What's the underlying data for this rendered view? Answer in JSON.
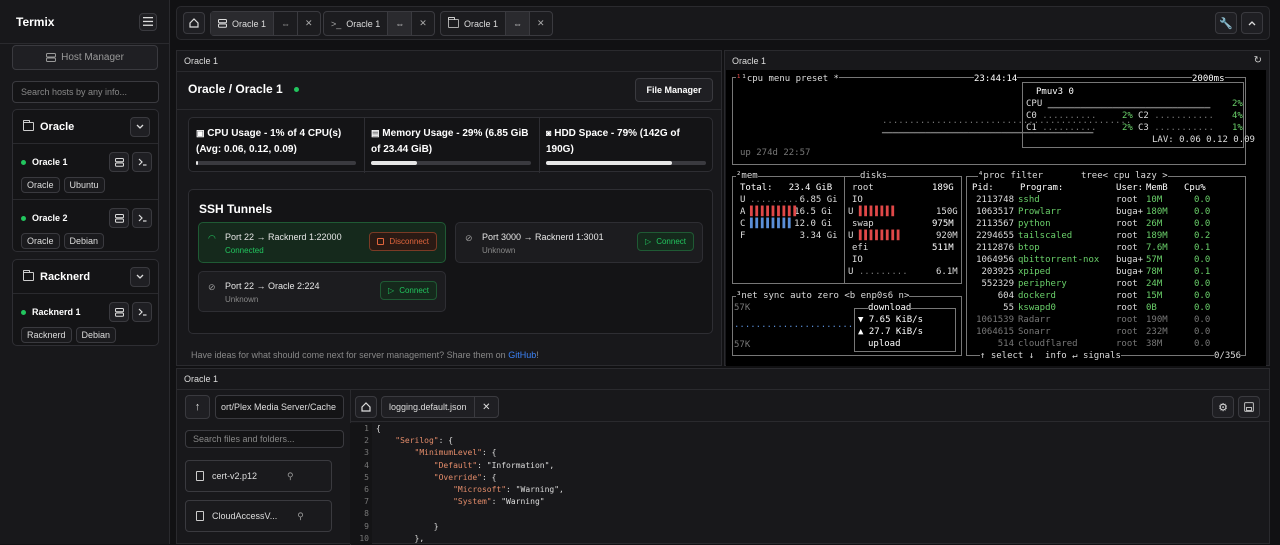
{
  "sidebar": {
    "app_title": "Termix",
    "host_manager": "Host Manager",
    "search_placeholder": "Search hosts by any info...",
    "groups": [
      {
        "name": "Oracle",
        "hosts": [
          {
            "name": "Oracle 1",
            "tags": [
              "Oracle",
              "Ubuntu"
            ]
          },
          {
            "name": "Oracle 2",
            "tags": [
              "Oracle",
              "Debian"
            ]
          }
        ]
      },
      {
        "name": "Racknerd",
        "hosts": [
          {
            "name": "Racknerd 1",
            "tags": [
              "Racknerd",
              "Debian"
            ]
          }
        ]
      }
    ]
  },
  "tabs": [
    {
      "label": "Oracle 1"
    },
    {
      "label": "Oracle 1"
    },
    {
      "label": "Oracle 1"
    }
  ],
  "server": {
    "panel_title": "Oracle 1",
    "heading": "Oracle / Oracle 1",
    "file_manager": "File Manager",
    "cpu": {
      "label": "CPU Usage - 1% of 4 CPU(s) (Avg: 0.06, 0.12, 0.09)",
      "percent": 1
    },
    "memory": {
      "label": "Memory Usage - 29% (6.85 GiB of 23.44 GiB)",
      "percent": 29
    },
    "hdd": {
      "label": "HDD Space - 79% (142G of 190G)",
      "percent": 79
    },
    "tunnels_title": "SSH Tunnels",
    "tunnels": [
      {
        "route": "Port 22 → Racknerd 1:22000",
        "status": "Connected",
        "action": "Disconnect"
      },
      {
        "route": "Port 3000 → Racknerd 1:3001",
        "status": "Unknown",
        "action": "Connect"
      },
      {
        "route": "Port 22 → Oracle 2:224",
        "status": "Unknown",
        "action": "Connect"
      }
    ],
    "footer_text": "Have ideas for what should come next for server management? Share them on",
    "footer_link": "GitHub",
    "footer_end": "!"
  },
  "terminal": {
    "title": "Oracle 1",
    "header_left": "¹cpu menu preset *",
    "clock": "23:44:14",
    "refresh": "2000ms",
    "uptime": "up 274d 22:57",
    "pmu": {
      "title": "Pmuv3 0",
      "cpu": "2%",
      "c0": "2%",
      "c1": "2%",
      "c2": "4%",
      "c3": "1%",
      "lav": "LAV: 0.06 0.12 0.09"
    },
    "mem": {
      "title": "²mem",
      "total": "Total:   23.4 GiB",
      "rows": [
        "U          6.85 Gi",
        "A         16.5 Gi",
        "C         12.0 Gi",
        "F          3.34 Gi"
      ]
    },
    "disks": {
      "title": "disks",
      "root": "root",
      "root_size": "189G",
      "io": "IO",
      "u1": "150G",
      "swap": "swap",
      "swap_size": "975M",
      "u2": "920M",
      "efi": "efi",
      "efi_size": "511M",
      "io2": "IO",
      "u3": "6.1M"
    },
    "net": {
      "title": "³net sync auto zero <b enp0s6 n>",
      "scale": "57K",
      "scale2": "57K",
      "download": "download",
      "down_rate": "▼ 7.65 KiB/s",
      "up_rate": "▲ 27.7 KiB/s",
      "upload": "upload"
    },
    "proc": {
      "header": "⁴proc filter       tree< cpu lazy >",
      "columns": [
        "Pid:",
        "Program:",
        "User:",
        "MemB",
        "Cpu%"
      ],
      "rows": [
        [
          "2113748",
          "sshd",
          "root",
          "10M",
          "0.0"
        ],
        [
          "1063517",
          "Prowlarr",
          "buga+",
          "180M",
          "0.0"
        ],
        [
          "2113567",
          "python",
          "root",
          "26M",
          "0.0"
        ],
        [
          "2294655",
          "tailscaled",
          "root",
          "189M",
          "0.2"
        ],
        [
          "2112876",
          "btop",
          "root",
          "7.6M",
          "0.1"
        ],
        [
          "1064956",
          "qbittorrent-nox",
          "buga+",
          "57M",
          "0.0"
        ],
        [
          "203925",
          "xpiped",
          "buga+",
          "78M",
          "0.1"
        ],
        [
          "552329",
          "periphery",
          "root",
          "24M",
          "0.0"
        ],
        [
          "604",
          "dockerd",
          "root",
          "15M",
          "0.0"
        ],
        [
          "55",
          "kswapd0",
          "root",
          "0B",
          "0.0"
        ],
        [
          "1061539",
          "Radarr",
          "root",
          "190M",
          "0.0"
        ],
        [
          "1064615",
          "Sonarr",
          "root",
          "232M",
          "0.0"
        ],
        [
          "514",
          "cloudflared",
          "root",
          "38M",
          "0.0"
        ]
      ],
      "footer_left": "↑ select ↓  info ↵ signals",
      "count": "0/356"
    }
  },
  "files": {
    "panel_title": "Oracle 1",
    "path": "ort/Plex Media Server/Cache",
    "search_placeholder": "Search files and folders...",
    "items": [
      "cert-v2.p12",
      "CloudAccessV..."
    ],
    "open_file": "logging.default.json"
  },
  "editor": {
    "line_numbers": [
      "1",
      "2",
      "3",
      "4",
      "5",
      "6",
      "7",
      "8",
      "9",
      "10"
    ],
    "lines": [
      "{",
      "    \"Serilog\": {",
      "        \"MinimumLevel\": {",
      "            \"Default\": \"Information\",",
      "            \"Override\": {",
      "                \"Microsoft\": \"Warning\",",
      "                \"System\": \"Warning\"",
      "",
      "            }",
      "        },"
    ]
  },
  "colors": {
    "accent_green": "#22c55e",
    "link_blue": "#3b82f6",
    "disconnect_red": "#e0653c"
  }
}
